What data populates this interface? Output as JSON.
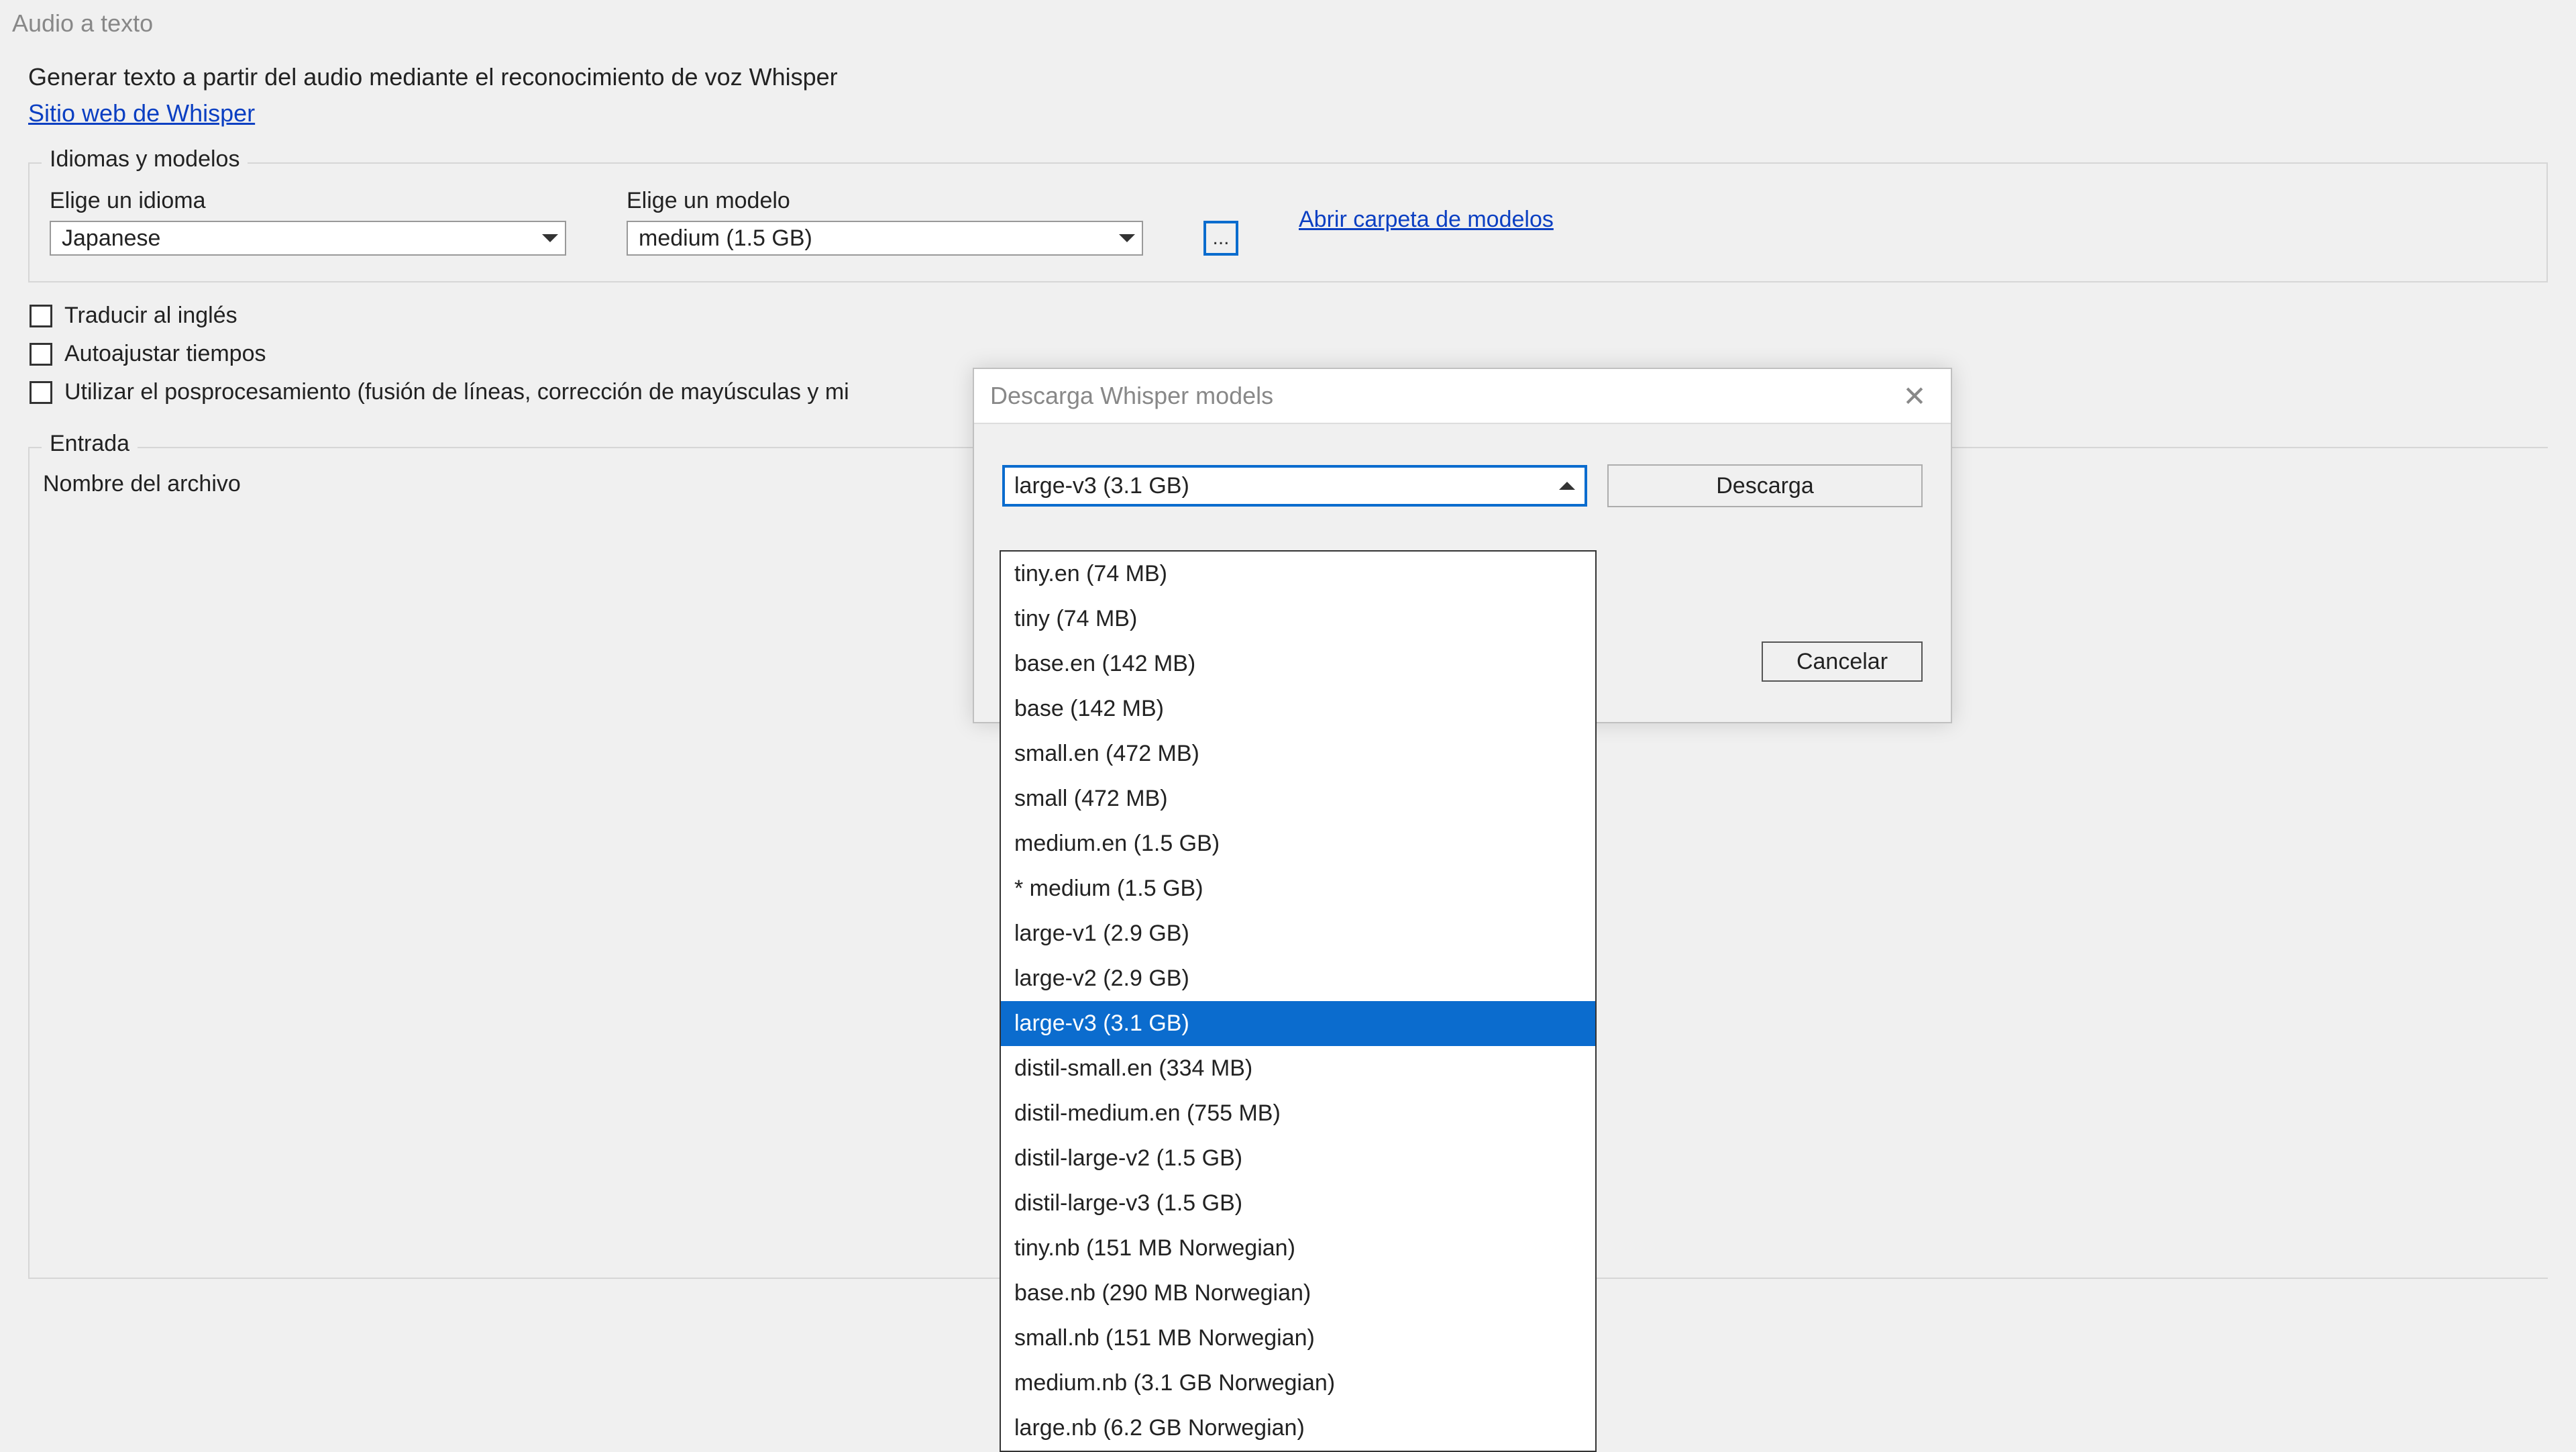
{
  "window": {
    "title": "Audio a texto"
  },
  "description": {
    "line1": "Generar texto a partir del audio mediante el reconocimiento de voz Whisper",
    "website_link": "Sitio web de Whisper"
  },
  "languages_group": {
    "title": "Idiomas y modelos",
    "language_label": "Elige un idioma",
    "language_value": "Japanese",
    "model_label": "Elige un modelo",
    "model_value": "medium (1.5 GB)",
    "more_button": "...",
    "open_folder_link": "Abrir carpeta de modelos"
  },
  "checkboxes": {
    "translate": "Traducir al inglés",
    "autoadjust": "Autoajustar tiempos",
    "postprocess": "Utilizar el posprocesamiento (fusión de líneas, corrección de mayúsculas y mi"
  },
  "input_group": {
    "title": "Entrada",
    "filename_label": "Nombre del archivo"
  },
  "modal": {
    "title": "Descarga Whisper models",
    "selected": "large-v3 (3.1 GB)",
    "download_btn": "Descarga",
    "cancel_btn": "Cancelar",
    "options": [
      "tiny.en (74 MB)",
      "tiny (74 MB)",
      "base.en (142 MB)",
      "base (142 MB)",
      "small.en (472 MB)",
      "small (472 MB)",
      "medium.en (1.5 GB)",
      "* medium (1.5 GB)",
      "large-v1 (2.9 GB)",
      "large-v2 (2.9 GB)",
      "large-v3 (3.1 GB)",
      "distil-small.en (334 MB)",
      "distil-medium.en (755 MB)",
      "distil-large-v2 (1.5 GB)",
      "distil-large-v3 (1.5 GB)",
      "tiny.nb (151 MB Norwegian)",
      "base.nb (290 MB Norwegian)",
      "small.nb (151 MB Norwegian)",
      "medium.nb (3.1 GB Norwegian)",
      "large.nb (6.2 GB Norwegian)"
    ],
    "selected_index": 10
  }
}
